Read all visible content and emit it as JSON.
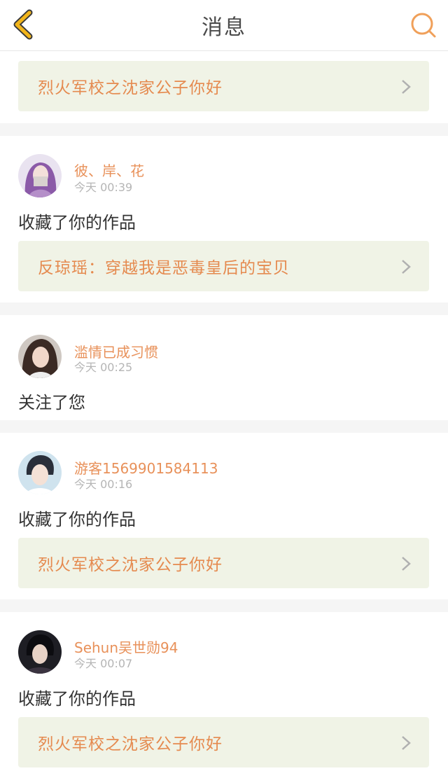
{
  "header": {
    "title": "消息"
  },
  "colors": {
    "accent": "#e8915a",
    "link_bg": "#f0f3e6",
    "back": "#f2b51b"
  },
  "top_card": {
    "link": "烈火军校之沈家公子你好"
  },
  "messages": [
    {
      "user": "彼、岸、花",
      "time": "今天 00:39",
      "action": "收藏了你的作品",
      "link": "反琼瑶：穿越我是恶毒皇后的宝贝"
    },
    {
      "user": "滥情已成习惯",
      "time": "今天 00:25",
      "action": "关注了您"
    },
    {
      "user": "游客1569901584113",
      "time": "今天 00:16",
      "action": "收藏了你的作品",
      "link": "烈火军校之沈家公子你好"
    },
    {
      "user": "Sehun吴世勋94",
      "time": "今天 00:07",
      "action": "收藏了你的作品",
      "link": "烈火军校之沈家公子你好"
    }
  ]
}
